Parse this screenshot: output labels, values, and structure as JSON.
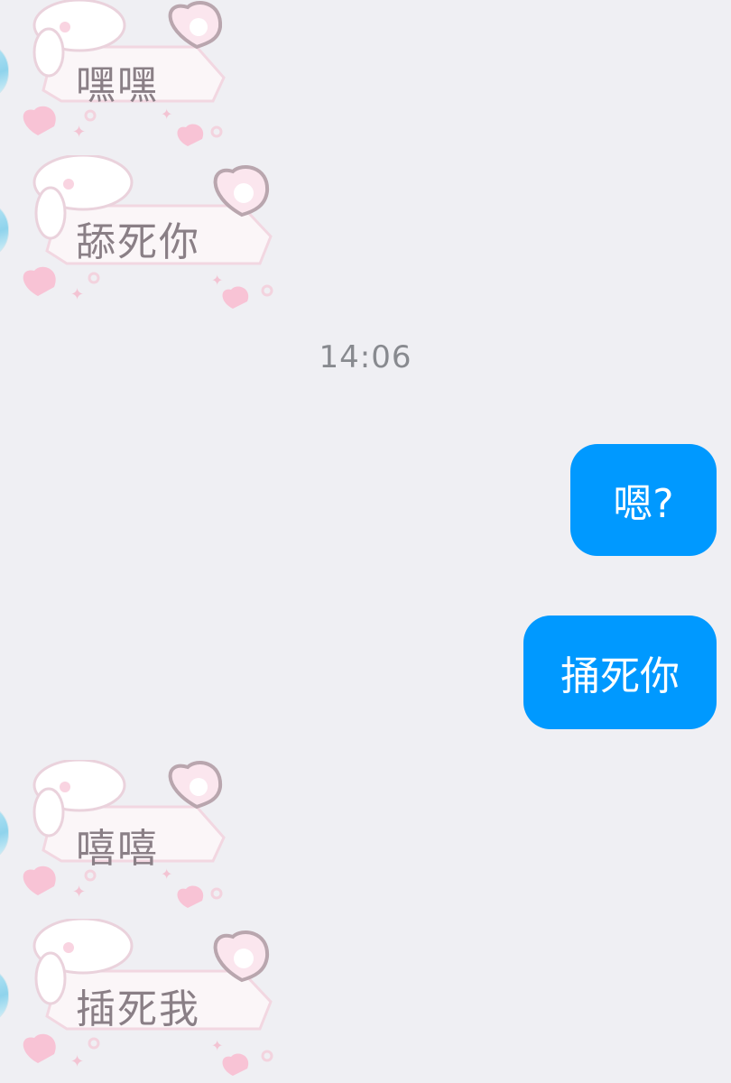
{
  "chat": {
    "timestamp": "14:06",
    "messages": [
      {
        "side": "left",
        "type": "sticker",
        "text": "嘿嘿"
      },
      {
        "side": "left",
        "type": "sticker",
        "text": "舔死你"
      },
      {
        "side": "right",
        "type": "bubble",
        "text": "嗯?"
      },
      {
        "side": "right",
        "type": "bubble",
        "text": "捅死你"
      },
      {
        "side": "left",
        "type": "sticker",
        "text": "嘻嘻"
      },
      {
        "side": "left",
        "type": "sticker",
        "text": "插死我"
      }
    ]
  },
  "colors": {
    "background": "#efeff3",
    "outgoing_bubble": "#0099ff",
    "sticker_pink": "#f7c6d6",
    "timestamp_text": "#888a8f"
  },
  "icons": [
    "avatar",
    "bunny-sticker-icon",
    "heart-icon",
    "sparkle-icon"
  ]
}
